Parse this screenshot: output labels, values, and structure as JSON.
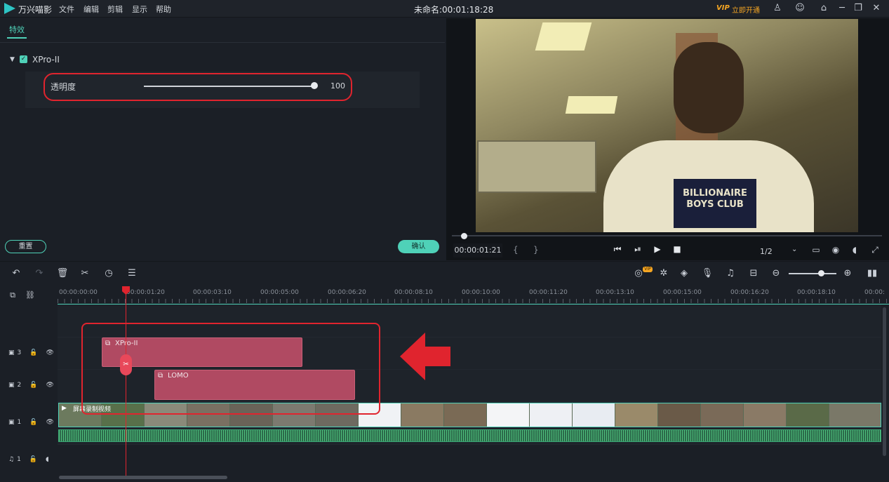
{
  "app": {
    "name": "万兴喵影",
    "doc_title": "未命名:00:01:18:28"
  },
  "menu": [
    "文件",
    "编辑",
    "剪辑",
    "显示",
    "帮助"
  ],
  "vip": {
    "badge": "VIP",
    "label": "立即开通"
  },
  "effects_panel": {
    "tab": "特效",
    "effect_name": "XPro-II",
    "effect_enabled": true,
    "opacity_label": "透明度",
    "opacity_value": "100",
    "opacity_level_percent": 100,
    "reset_label": "重置",
    "confirm_label": "确认"
  },
  "preview": {
    "timecode": "00:00:01:21",
    "page": "1/2",
    "shirt_text": "BILLIONAIRE BOYS CLUB"
  },
  "ruler": {
    "ticks": [
      "00:00:00:00",
      "00:00:01:20",
      "00:00:03:10",
      "00:00:05:00",
      "00:00:06:20",
      "00:00:08:10",
      "00:00:10:00",
      "00:00:11:20",
      "00:00:13:10",
      "00:00:15:00",
      "00:00:16:20",
      "00:00:18:10",
      "00:00:"
    ]
  },
  "tracks": {
    "labels": [
      "3",
      "2",
      "1",
      "1"
    ],
    "clip_xpro": "XPro-II",
    "clip_lomo": "LOMO",
    "video_clip_name": "屏幕录制视频"
  },
  "colors": {
    "accent": "#4fd1b8",
    "highlight": "#e0242e",
    "effect_clip": "#b04a62",
    "vip": "#f5a623"
  }
}
